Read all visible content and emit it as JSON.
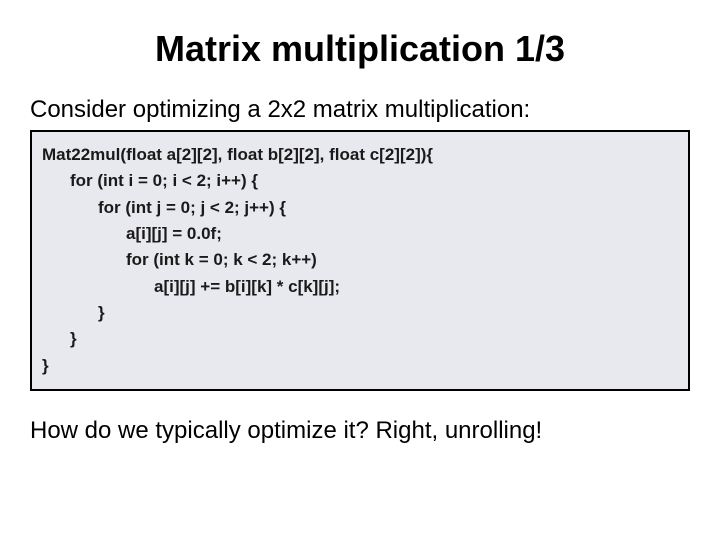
{
  "title": "Matrix multiplication 1/3",
  "lead": "Consider optimizing a 2x2 matrix multiplication:",
  "code": {
    "l0": "Mat22mul(float a[2][2], float b[2][2], float c[2][2]){",
    "l1": "for (int i = 0; i < 2; i++) {",
    "l2": "for (int j = 0; j < 2; j++) {",
    "l3": "a[i][j] = 0.0f;",
    "l4": "for (int k = 0; k < 2; k++)",
    "l5": "a[i][j] += b[i][k] * c[k][j];",
    "l6": "}",
    "l7": "}",
    "l8": "}"
  },
  "closing": "How do we typically optimize it? Right, unrolling!"
}
